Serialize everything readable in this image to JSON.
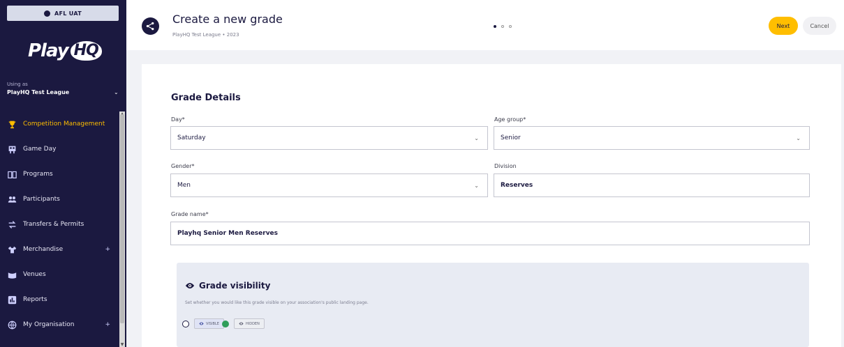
{
  "env": {
    "label": "AFL UAT"
  },
  "brand": {
    "logo_play": "Play",
    "logo_hq": "HQ"
  },
  "org": {
    "using_label": "Using as",
    "name": "PlayHQ Test League"
  },
  "sidebar": {
    "items": [
      {
        "label": "Competition Management",
        "icon": "trophy-icon",
        "active": true
      },
      {
        "label": "Game Day",
        "icon": "scoreboard-icon"
      },
      {
        "label": "Programs",
        "icon": "book-icon"
      },
      {
        "label": "Participants",
        "icon": "people-icon"
      },
      {
        "label": "Transfers & Permits",
        "icon": "transfer-icon"
      },
      {
        "label": "Merchandise",
        "icon": "merch-icon",
        "expandable": true
      },
      {
        "label": "Venues",
        "icon": "venue-icon"
      },
      {
        "label": "Reports",
        "icon": "reports-icon"
      },
      {
        "label": "My Organisation",
        "icon": "globe-icon",
        "expandable": true
      }
    ],
    "expand_symbol": "+"
  },
  "header": {
    "title": "Create a new grade",
    "subtitle": "PlayHQ Test League • 2023",
    "steps": {
      "total": 3,
      "current": 1
    },
    "next_label": "Next",
    "cancel_label": "Cancel"
  },
  "form": {
    "section_title": "Grade Details",
    "day": {
      "label": "Day*",
      "value": "Saturday"
    },
    "age_group": {
      "label": "Age group*",
      "value": "Senior"
    },
    "gender": {
      "label": "Gender*",
      "value": "Men"
    },
    "division": {
      "label": "Division",
      "value": "Reserves"
    },
    "grade_name": {
      "label": "Grade name*",
      "value": "Playhq Senior Men Reserves"
    }
  },
  "visibility": {
    "title": "Grade visibility",
    "description": "Set whether you would like this grade visible on your association's public landing page.",
    "options": [
      {
        "label": "VISIBLE",
        "selected": false
      },
      {
        "label": "HIDDEN",
        "selected": true
      }
    ]
  },
  "colors": {
    "navy": "#1b1940",
    "accent": "#ffbe00",
    "selected_green": "#2f9e5a"
  }
}
